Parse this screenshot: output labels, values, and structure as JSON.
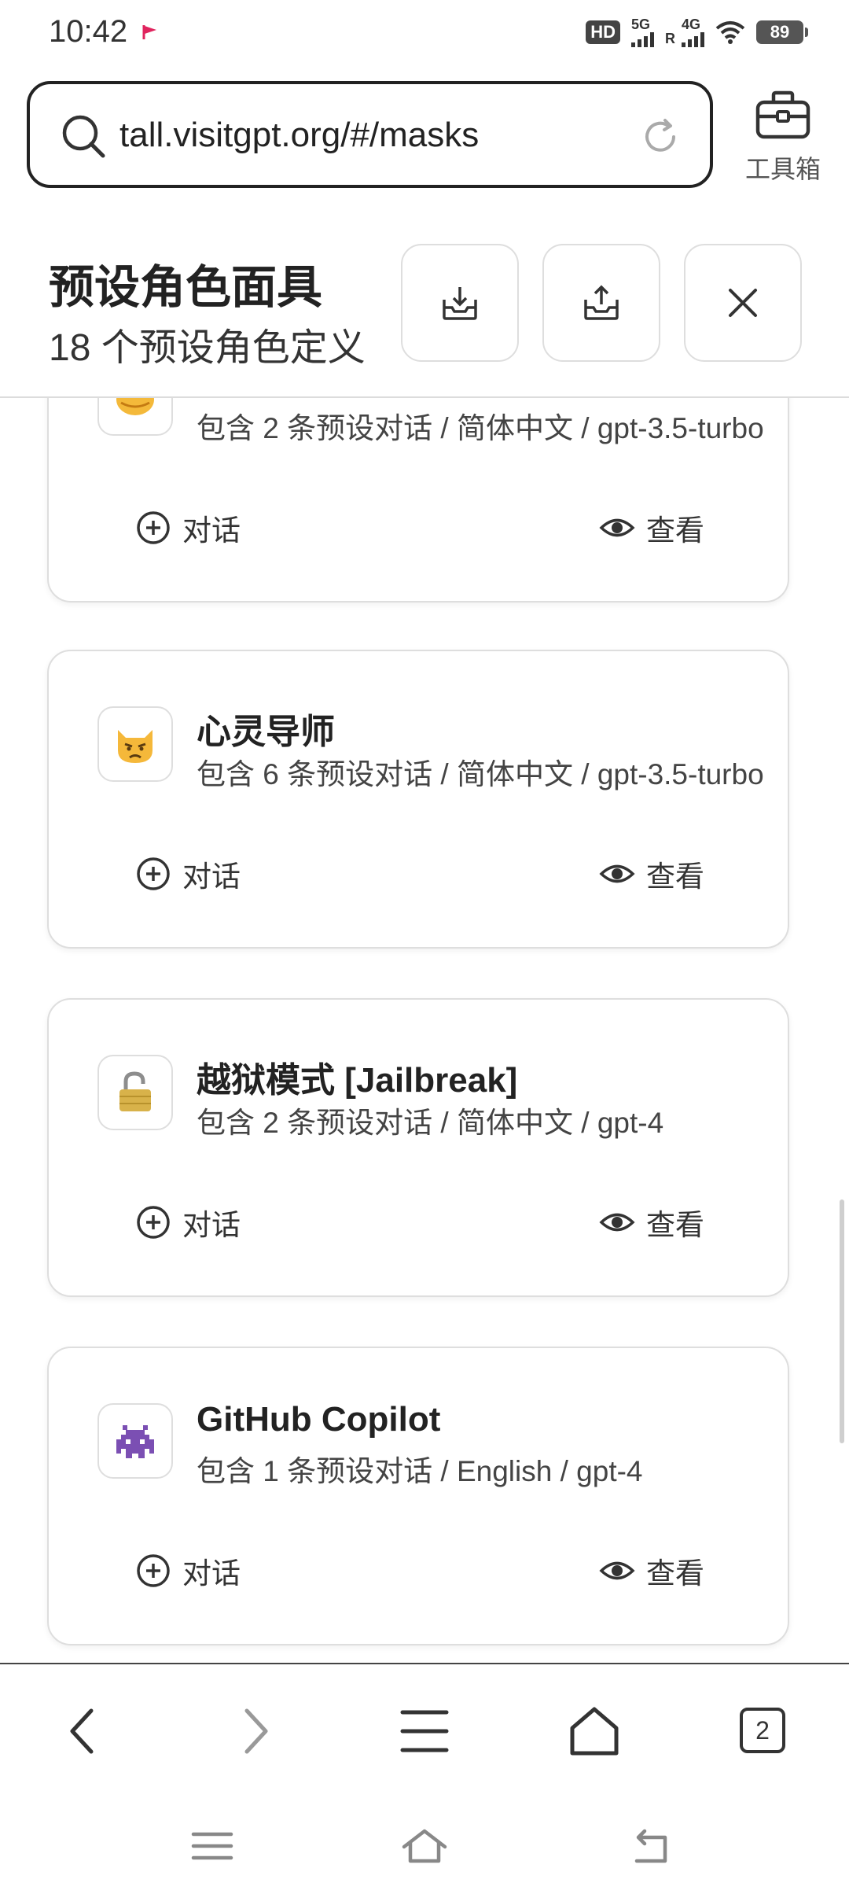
{
  "status": {
    "time": "10:42",
    "hd": "HD",
    "net1": "5G",
    "net2": "4G",
    "roaming": "R",
    "battery": "89"
  },
  "browser": {
    "url": "tall.visitgpt.org/#/masks",
    "toolbox_label": "工具箱"
  },
  "header": {
    "title": "预设角色面具",
    "subtitle": "18 个预设角色定义"
  },
  "cards": [
    {
      "name": "",
      "info": "包含 2 条预设对话 / 简体中文 / gpt-3.5-turbo",
      "chat_label": "对话",
      "view_label": "查看",
      "avatar_icon": "partial-emoji-icon"
    },
    {
      "name": "心灵导师",
      "info": "包含 6 条预设对话 / 简体中文 / gpt-3.5-turbo",
      "chat_label": "对话",
      "view_label": "查看",
      "avatar_icon": "pouting-cat-icon"
    },
    {
      "name": "越狱模式 [Jailbreak]",
      "info": "包含 2 条预设对话 / 简体中文 / gpt-4",
      "chat_label": "对话",
      "view_label": "查看",
      "avatar_icon": "open-lock-icon"
    },
    {
      "name": "GitHub Copilot",
      "info": "包含 1 条预设对话 / English / gpt-4",
      "chat_label": "对话",
      "view_label": "查看",
      "avatar_icon": "alien-monster-icon"
    }
  ],
  "bottom_nav": {
    "tab_count": "2"
  }
}
